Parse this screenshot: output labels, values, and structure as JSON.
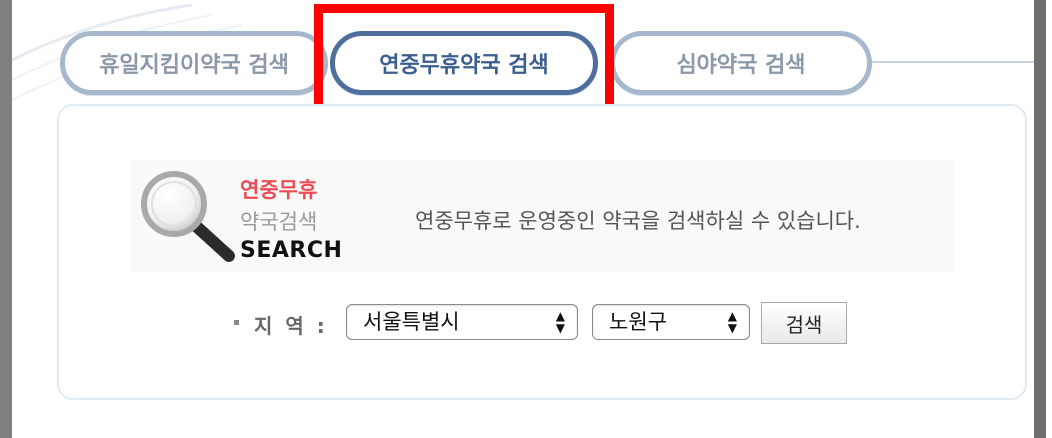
{
  "tabs": {
    "holiday_label": "휴일지킴이약국 검색",
    "yearround_label": "연중무휴약국 검색",
    "night_label": "심야약국 검색"
  },
  "banner": {
    "title_red": "연중무휴",
    "title_gray": "약국검색",
    "title_search": "SEARCH",
    "description": "연중무휴로 운영중인 약국을 검색하실 수 있습니다."
  },
  "form": {
    "area_label": "지 역 :",
    "city_value": "서울특별시",
    "district_value": "노원구",
    "search_button": "검색"
  },
  "colors": {
    "highlight": "#ff0000",
    "active_tab": "#4e6f9e",
    "inactive_tab": "#a7b8cd",
    "accent_red": "#ef4b57"
  },
  "icons": [
    "magnifier-icon",
    "up-down-arrows-icon"
  ]
}
